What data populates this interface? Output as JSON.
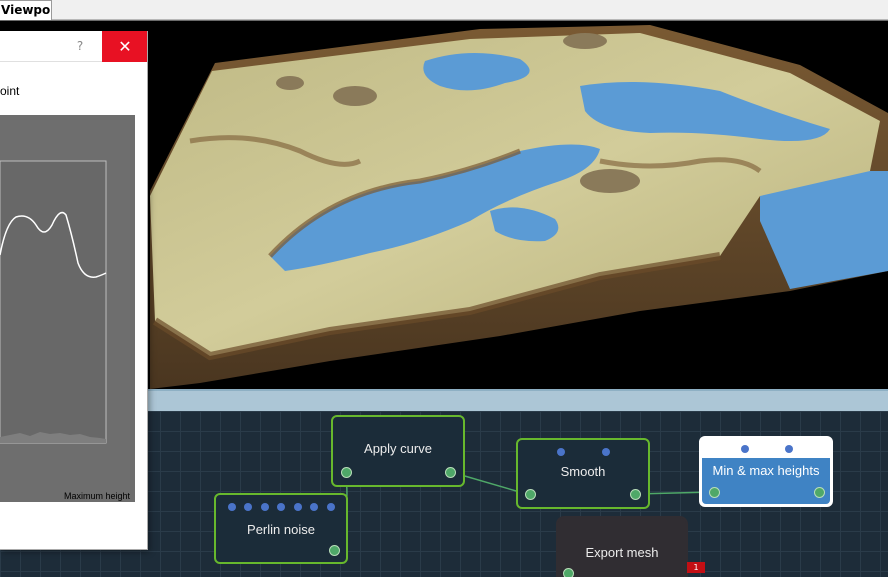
{
  "tabs": [
    {
      "label": "Viewport"
    }
  ],
  "dialog": {
    "help_glyph": "?",
    "close_glyph": "✕",
    "label": "oint",
    "axis_label": "Maximum height"
  },
  "graph": {
    "nodes": [
      {
        "title": "Apply curve",
        "input_ports": 0,
        "output_ports": 2
      },
      {
        "title": "Smooth",
        "input_ports": 2,
        "output_ports": 2
      },
      {
        "title": "Min & max heights",
        "input_ports": 2,
        "output_ports": 2,
        "selected": true
      },
      {
        "title": "Perlin noise",
        "input_ports": 7,
        "output_ports": 1
      },
      {
        "title": "Export mesh",
        "input_ports": 0,
        "output_ports": 1,
        "badge": "1"
      }
    ]
  },
  "colors": {
    "accent_green": "#67b82d",
    "selected_blue": "#3f83c4",
    "close_red": "#e81123",
    "water": "#5b9bd5",
    "terrain": "#c9c48e"
  }
}
